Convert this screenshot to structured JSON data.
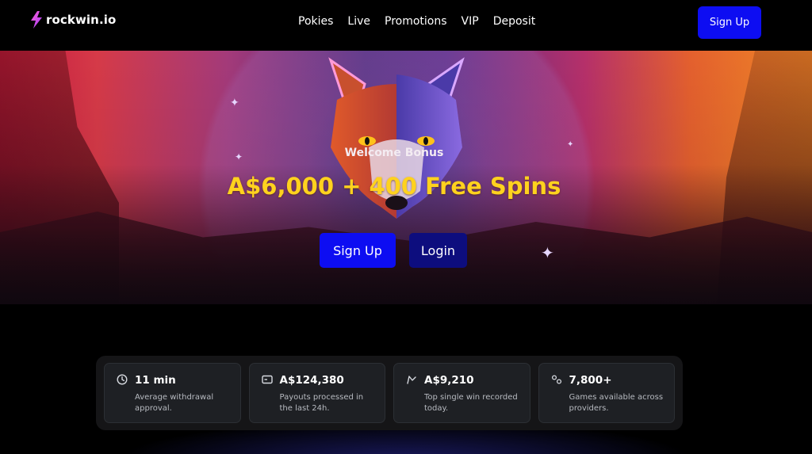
{
  "header": {
    "logo_text": "rockwin.io",
    "nav": [
      {
        "label": "Pokies"
      },
      {
        "label": "Live"
      },
      {
        "label": "Promotions"
      },
      {
        "label": "VIP"
      },
      {
        "label": "Deposit"
      }
    ],
    "signup_label": "Sign Up"
  },
  "hero": {
    "welcome": "Welcome Bonus",
    "headline": "A$6,000 + 400 Free Spins",
    "signup_label": "Sign Up",
    "login_label": "Login"
  },
  "stats": [
    {
      "icon": "clock-icon",
      "value": "11 min",
      "description": "Average withdrawal approval."
    },
    {
      "icon": "card-icon",
      "value": "A$124,380",
      "description": "Payouts processed in the last 24h."
    },
    {
      "icon": "trend-icon",
      "value": "A$9,210",
      "description": "Top single win recorded today."
    },
    {
      "icon": "games-icon",
      "value": "7,800+",
      "description": "Games available across providers."
    }
  ],
  "colors": {
    "accent_blue": "#0d0df2",
    "login_blue": "#0d0d7e",
    "headline_yellow": "#ffd21e",
    "background": "#000000"
  }
}
